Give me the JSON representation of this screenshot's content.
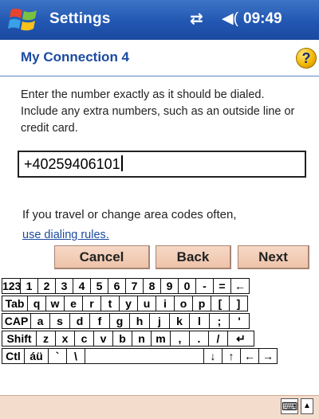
{
  "titlebar": {
    "app_title": "Settings",
    "clock": "09:49",
    "connectivity_glyph": "⇄",
    "speaker_glyph": "◀︎("
  },
  "header": {
    "title": "My Connection 4",
    "help_glyph": "?"
  },
  "main": {
    "instructions": "Enter the number exactly as it should be dialed.  Include any extra numbers, such as an outside line or credit card.",
    "phone_number": "+40259406101",
    "travel_text": "If you travel or change area codes often,",
    "dialing_rules_link": "use dialing rules."
  },
  "buttons": {
    "cancel": "Cancel",
    "back": "Back",
    "next": "Next"
  },
  "keyboard": {
    "rows": [
      [
        "123",
        "1",
        "2",
        "3",
        "4",
        "5",
        "6",
        "7",
        "8",
        "9",
        "0",
        "-",
        "=",
        "←"
      ],
      [
        "Tab",
        "q",
        "w",
        "e",
        "r",
        "t",
        "y",
        "u",
        "i",
        "o",
        "p",
        "[",
        "]"
      ],
      [
        "CAP",
        "a",
        "s",
        "d",
        "f",
        "g",
        "h",
        "j",
        "k",
        "l",
        ";",
        "'"
      ],
      [
        "Shift",
        "z",
        "x",
        "c",
        "v",
        "b",
        "n",
        "m",
        ",",
        ".",
        "/",
        "↵"
      ],
      [
        "Ctl",
        "áü",
        "`",
        "\\",
        "",
        "↓",
        "↑",
        "←",
        "→"
      ]
    ]
  },
  "bottombar": {
    "sip_icon": "⌨",
    "sip_arrow": "▲"
  },
  "colors": {
    "titlebar": "#2257b2",
    "accent": "#1c4aa1",
    "button_bg": "#f4dccd"
  }
}
